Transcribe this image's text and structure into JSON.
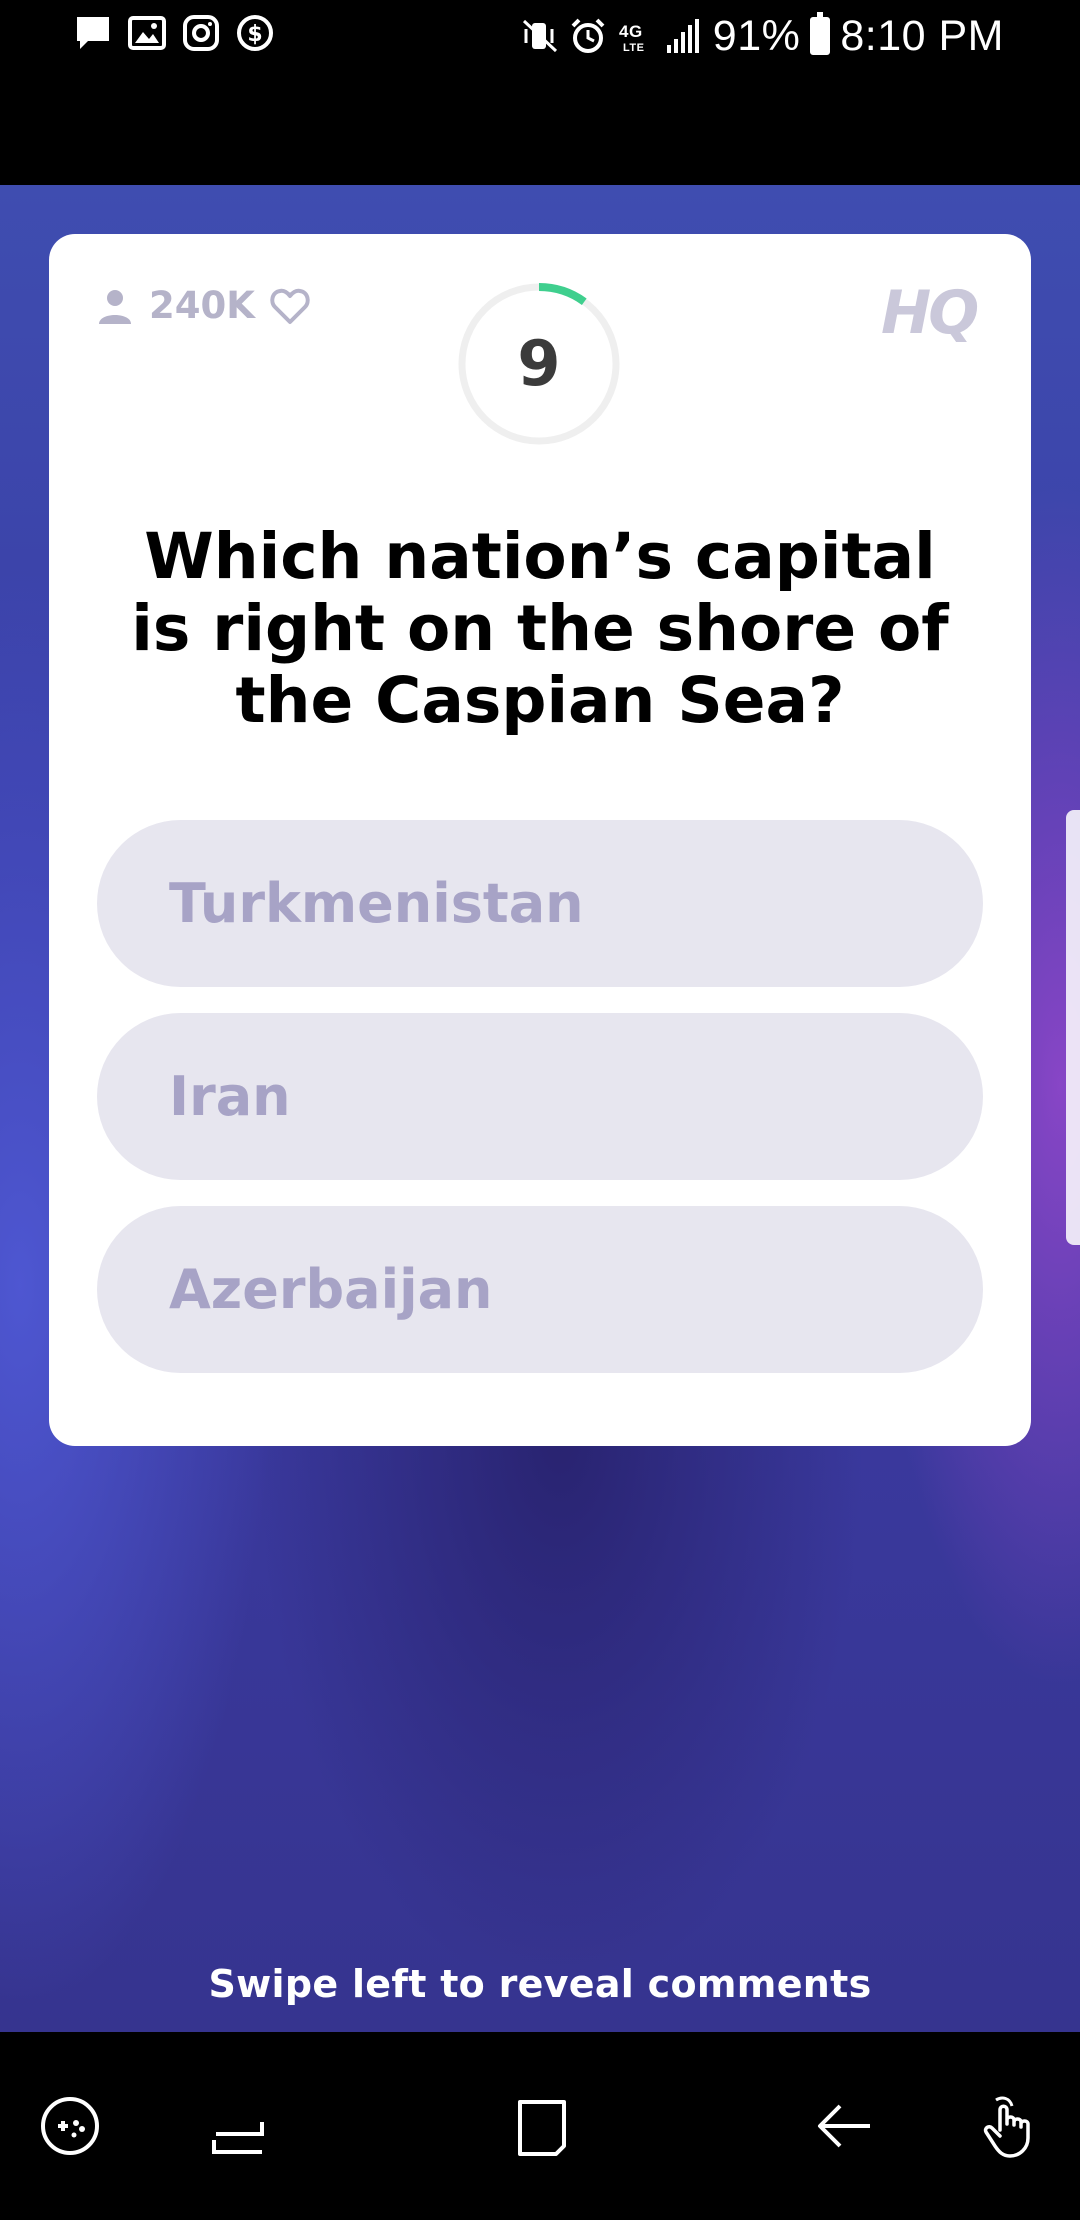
{
  "status_bar": {
    "battery": "91%",
    "time": "8:10 PM",
    "network": "4G LTE",
    "left_icons": [
      "message-icon",
      "image-icon",
      "instagram-icon",
      "dollar-sync-icon"
    ],
    "right_icons": [
      "vibrate-mute-icon",
      "alarm-icon",
      "lte-icon",
      "signal-icon",
      "battery-icon"
    ]
  },
  "card": {
    "viewer_count": "240K",
    "timer": "9",
    "timer_progress": 0.1,
    "logo": "HQ",
    "question": "Which nation’s capital is right on the shore of the Caspian Sea?",
    "answers": [
      {
        "label": "Turkmenistan"
      },
      {
        "label": "Iran"
      },
      {
        "label": "Azerbaijan"
      }
    ]
  },
  "swipe_hint": "Swipe left to reveal comments",
  "nav_bar": {
    "buttons": [
      "game-tools-icon",
      "recent-apps-icon",
      "home-icon",
      "back-icon",
      "gesture-icon"
    ]
  },
  "colors": {
    "card_bg": "#ffffff",
    "answer_bg": "#e7e6ef",
    "answer_text": "#a7a3c6",
    "timer_accent": "#3fcf8e",
    "muted_gray": "#b5b3c9"
  }
}
